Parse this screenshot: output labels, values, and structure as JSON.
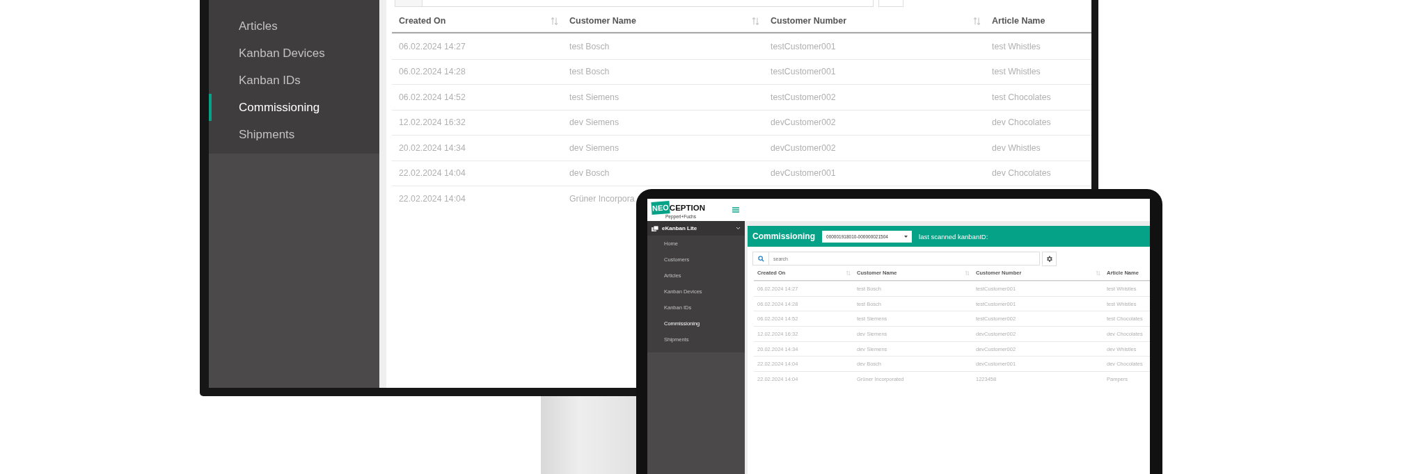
{
  "monitor": {
    "sidebar": {
      "items": [
        {
          "label": "Articles",
          "selected": false
        },
        {
          "label": "Kanban Devices",
          "selected": false
        },
        {
          "label": "Kanban IDs",
          "selected": false
        },
        {
          "label": "Commissioning",
          "selected": true
        },
        {
          "label": "Shipments",
          "selected": false
        }
      ]
    },
    "table": {
      "columns": [
        {
          "label": "Created On",
          "sortable": true
        },
        {
          "label": "Customer Name",
          "sortable": true
        },
        {
          "label": "Customer Number",
          "sortable": true
        },
        {
          "label": "Article Name",
          "sortable": false
        }
      ],
      "rows": [
        [
          "06.02.2024 14:27",
          "test Bosch",
          "testCustomer001",
          "test Whistles"
        ],
        [
          "06.02.2024 14:28",
          "test Bosch",
          "testCustomer001",
          "test Whistles"
        ],
        [
          "06.02.2024 14:52",
          "test Siemens",
          "testCustomer002",
          "test Chocolates"
        ],
        [
          "12.02.2024 16:32",
          "dev Siemens",
          "devCustomer002",
          "dev Chocolates"
        ],
        [
          "20.02.2024 14:34",
          "dev Siemens",
          "devCustomer002",
          "dev Whistles"
        ],
        [
          "22.02.2024 14:04",
          "dev Bosch",
          "devCustomer001",
          "dev Chocolates"
        ],
        [
          "22.02.2024 14:04",
          "Grüner Incorpora"
        ]
      ]
    }
  },
  "laptop": {
    "logo": {
      "highlight": "NEO",
      "rest": "CEPTION",
      "tagline": "Pepperl+Fuchs"
    },
    "sidebar": {
      "section": {
        "label": "eKanban Lite",
        "expanded": true
      },
      "items": [
        {
          "label": "Home",
          "selected": false
        },
        {
          "label": "Customers",
          "selected": false
        },
        {
          "label": "Articles",
          "selected": false
        },
        {
          "label": "Kanban Devices",
          "selected": false
        },
        {
          "label": "Kanban IDs",
          "selected": false
        },
        {
          "label": "Commissioning",
          "selected": true
        },
        {
          "label": "Shipments",
          "selected": false
        }
      ]
    },
    "header": {
      "title": "Commissioning",
      "dropdown_value": "000001918010-000000021504",
      "note": "last scanned kanbanID:"
    },
    "search": {
      "placeholder": "search"
    },
    "table": {
      "columns": [
        {
          "label": "Created On",
          "sortable": true
        },
        {
          "label": "Customer Name",
          "sortable": true
        },
        {
          "label": "Customer Number",
          "sortable": true
        },
        {
          "label": "Article Name",
          "sortable": false
        }
      ],
      "rows": [
        [
          "06.02.2024 14:27",
          "test Bosch",
          "testCustomer001",
          "test Whistles"
        ],
        [
          "06.02.2024 14:28",
          "test Bosch",
          "testCustomer001",
          "test Whistles"
        ],
        [
          "06.02.2024 14:52",
          "test Siemens",
          "testCustomer002",
          "test Chocolates"
        ],
        [
          "12.02.2024 16:32",
          "dev Siemens",
          "devCustomer002",
          "dev Chocolates"
        ],
        [
          "20.02.2024 14:34",
          "dev Siemens",
          "devCustomer002",
          "dev Whistles"
        ],
        [
          "22.02.2024 14:04",
          "dev Bosch",
          "devCustomer001",
          "dev Chocolates"
        ],
        [
          "22.02.2024 14:04",
          "Grüner Incorporated",
          "1223458",
          "Pampers"
        ]
      ]
    }
  }
}
